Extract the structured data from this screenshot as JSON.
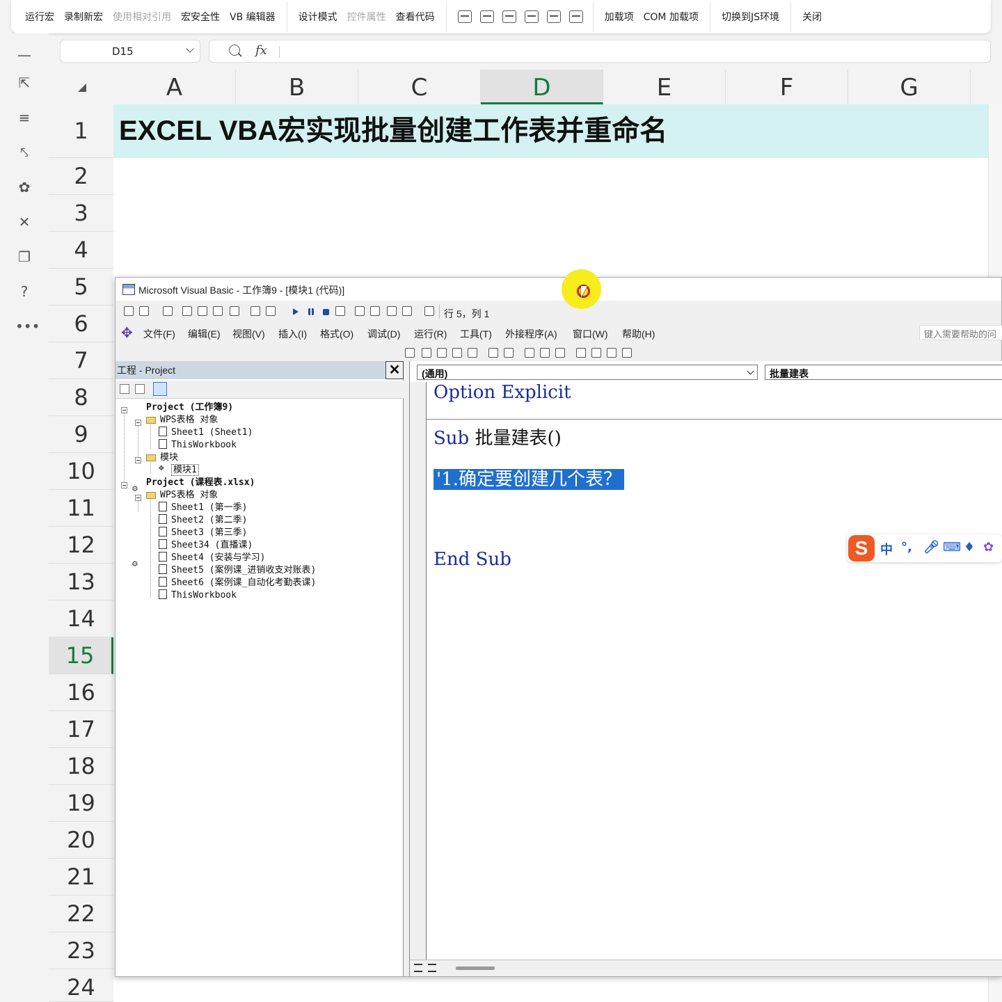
{
  "ribbon": {
    "group1": [
      "运行宏",
      "录制新宏",
      "使用相对引用",
      "宏安全性",
      "VB 编辑器"
    ],
    "group2": [
      "设计模式",
      "控件属性",
      "查看代码"
    ],
    "group4": [
      "加载项",
      "COM 加载项"
    ],
    "switch_js": "切换到JS环境",
    "close": "关闭"
  },
  "namebox": {
    "value": "D15"
  },
  "formula_bar": {
    "fx": "fx",
    "value": ""
  },
  "grid": {
    "columns": [
      "A",
      "B",
      "C",
      "D",
      "E",
      "F",
      "G"
    ],
    "active_column": "D",
    "rows": [
      "1",
      "2",
      "3",
      "4",
      "5",
      "6",
      "7",
      "8",
      "9",
      "10",
      "11",
      "12",
      "13",
      "14",
      "15",
      "16",
      "17",
      "18",
      "19",
      "20",
      "21",
      "22",
      "23",
      "24"
    ],
    "active_row": "15",
    "title_cell": "EXCEL VBA宏实现批量创建工作表并重命名"
  },
  "vbe": {
    "title": "Microsoft Visual Basic - 工作簿9 - [模块1 (代码)]",
    "cursor_pos": "行 5，列 1",
    "menu": [
      "文件(F)",
      "编辑(E)",
      "视图(V)",
      "插入(I)",
      "格式(O)",
      "调试(D)",
      "运行(R)",
      "工具(T)",
      "外接程序(A)",
      "窗口(W)",
      "帮助(H)"
    ],
    "help_placeholder": "键入需要帮助的问",
    "project_pane": {
      "title": "工程 - Project",
      "tree": {
        "p1": "Project (工作簿9)",
        "p1_objects": "WPS表格 对象",
        "p1_sheet1": "Sheet1 (Sheet1)",
        "p1_thisworkbook": "ThisWorkbook",
        "p1_modules": "模块",
        "p1_module1": "模块1",
        "p2": "Project (课程表.xlsx)",
        "p2_objects": "WPS表格 对象",
        "p2_sheets": [
          "Sheet1 (第一季)",
          "Sheet2 (第二季)",
          "Sheet3 (第三季)",
          "Sheet34 (直播课)",
          "Sheet4 (安装与学习)",
          "Sheet5 (案例课_进销收支对账表)",
          "Sheet6 (案例课_自动化考勤表课)",
          "ThisWorkbook"
        ]
      }
    },
    "code_pane": {
      "object_combo": "(通用)",
      "proc_combo": "批量建表",
      "line1_kw": "Option Explicit",
      "line2_kw": "Sub",
      "line2_rest": " 批量建表()",
      "line3_comment": "'1.确定要创建几个表？",
      "line4_kw": "End Sub"
    }
  },
  "ime": {
    "logo": "S",
    "lang": "中",
    "punct": "°,",
    "icons": [
      "mic-icon",
      "keyboard-icon",
      "skin-icon",
      "apps-icon"
    ]
  }
}
